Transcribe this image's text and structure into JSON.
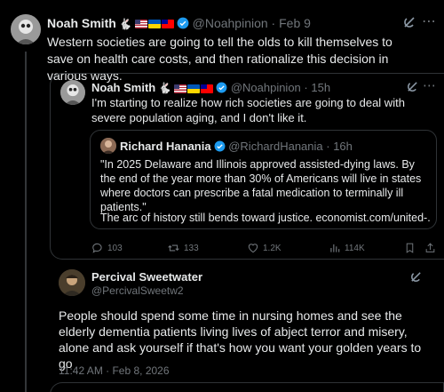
{
  "outer_tweet": {
    "name": "Noah Smith",
    "handle": "@Noahpinion",
    "time": "Feb 9",
    "text": "Western societies are going to tell the olds to kill themselves to save on health care costs, and then rationalize this decision in various ways.",
    "badges": [
      "rabbit-emoji",
      "flag-us",
      "flag-ua",
      "flag-tw",
      "verified-icon"
    ]
  },
  "quoted_tweet": {
    "name": "Noah Smith",
    "handle": "@Noahpinion",
    "time": "15h",
    "text": "I'm starting to realize how rich societies are going to deal with severe population aging, and I don't like it.",
    "nested": {
      "name": "Richard Hanania",
      "handle": "@RichardHanania",
      "time": "16h",
      "text": "\"In 2025 Delaware and Illinois approved assisted-dying laws. By the end of the year more than 30% of Americans will live in states where doctors can prescribe a fatal medication to terminally ill patients.\"",
      "text2": "The arc of history still bends toward justice. economist.com/united-..."
    },
    "actions": {
      "replies": "103",
      "reposts": "133",
      "likes": "1.2K",
      "views": "114K"
    }
  },
  "reply": {
    "name": "Percival Sweetwater",
    "handle": "@PercivalSweetw2",
    "text": "People should spend some time in nursing homes and see the elderly dementia patients living lives of abject terror and misery, alone and ask yourself if that's how you want your golden years to go",
    "timestamp": "11:42 AM · Feb 8, 2026"
  },
  "colors": {
    "background": "#000000",
    "text": "#e7e9ea",
    "muted": "#71767b",
    "border": "#2f3336",
    "verified": "#1d9bf0"
  },
  "separator": " · "
}
